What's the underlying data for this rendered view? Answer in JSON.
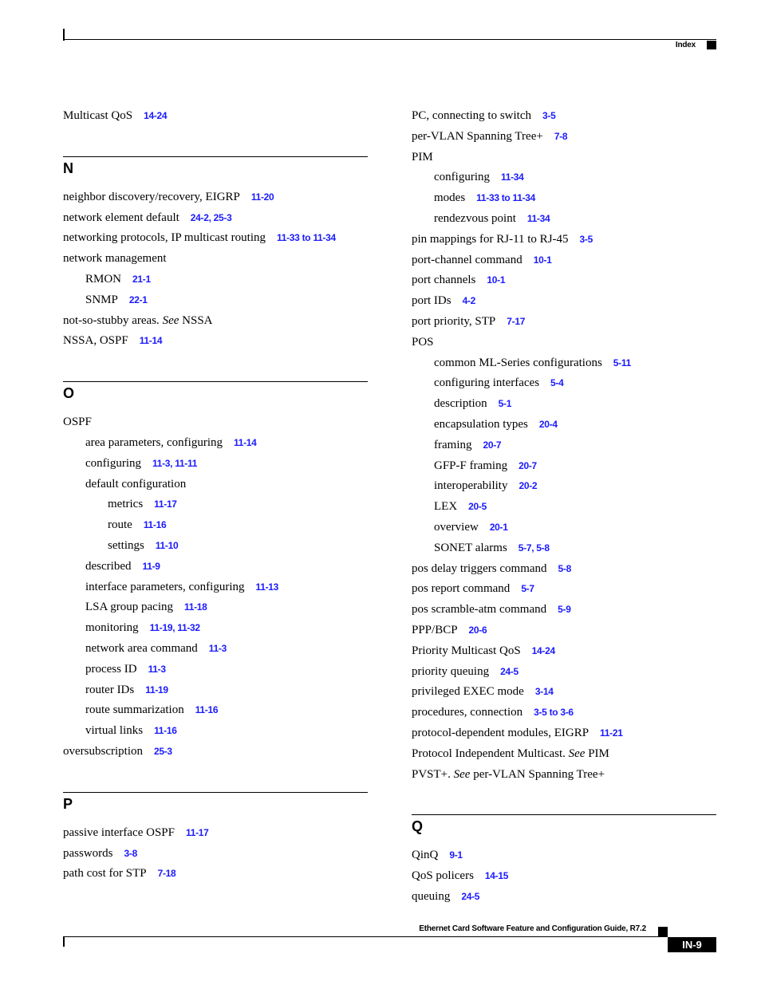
{
  "header": {
    "label": "Index"
  },
  "footer": {
    "title": "Ethernet Card Software Feature and Configuration Guide, R7.2",
    "page": "IN-9"
  },
  "colors": {
    "link": "#1a1aff",
    "text": "#000000"
  },
  "left": {
    "top_entries": [
      {
        "term": "Multicast QoS",
        "pages": "14-24"
      }
    ],
    "sections": [
      {
        "letter": "N",
        "entries": [
          {
            "term": "neighbor discovery/recovery, EIGRP",
            "pages": "11-20",
            "level": 0
          },
          {
            "term": "network element default",
            "pages": "24-2, 25-3",
            "level": 0
          },
          {
            "term": "networking protocols, IP multicast routing",
            "pages": "11-33 to 11-34",
            "level": 0
          },
          {
            "term": "network management",
            "pages": "",
            "level": 0
          },
          {
            "term": "RMON",
            "pages": "21-1",
            "level": 1
          },
          {
            "term": "SNMP",
            "pages": "22-1",
            "level": 1
          },
          {
            "term": "not-so-stubby areas.",
            "see": "See",
            "see_target": "NSSA",
            "pages": "",
            "level": 0
          },
          {
            "term": "NSSA, OSPF",
            "pages": "11-14",
            "level": 0
          }
        ]
      },
      {
        "letter": "O",
        "entries": [
          {
            "term": "OSPF",
            "pages": "",
            "level": 0
          },
          {
            "term": "area parameters, configuring",
            "pages": "11-14",
            "level": 1
          },
          {
            "term": "configuring",
            "pages": "11-3, 11-11",
            "level": 1
          },
          {
            "term": "default configuration",
            "pages": "",
            "level": 1
          },
          {
            "term": "metrics",
            "pages": "11-17",
            "level": 2
          },
          {
            "term": "route",
            "pages": "11-16",
            "level": 2
          },
          {
            "term": "settings",
            "pages": "11-10",
            "level": 2
          },
          {
            "term": "described",
            "pages": "11-9",
            "level": 1
          },
          {
            "term": "interface parameters, configuring",
            "pages": "11-13",
            "level": 1
          },
          {
            "term": "LSA group pacing",
            "pages": "11-18",
            "level": 1
          },
          {
            "term": "monitoring",
            "pages": "11-19, 11-32",
            "level": 1
          },
          {
            "term": "network area command",
            "pages": "11-3",
            "level": 1
          },
          {
            "term": "process ID",
            "pages": "11-3",
            "level": 1
          },
          {
            "term": "router IDs",
            "pages": "11-19",
            "level": 1
          },
          {
            "term": "route summarization",
            "pages": "11-16",
            "level": 1
          },
          {
            "term": "virtual links",
            "pages": "11-16",
            "level": 1
          },
          {
            "term": "oversubscription",
            "pages": "25-3",
            "level": 0
          }
        ]
      },
      {
        "letter": "P",
        "entries": [
          {
            "term": "passive interface OSPF",
            "pages": "11-17",
            "level": 0
          },
          {
            "term": "passwords",
            "pages": "3-8",
            "level": 0
          },
          {
            "term": "path cost for STP",
            "pages": "7-18",
            "level": 0
          }
        ]
      }
    ]
  },
  "right": {
    "top_entries": [
      {
        "term": "PC, connecting to switch",
        "pages": "3-5",
        "level": 0
      },
      {
        "term": "per-VLAN Spanning Tree+",
        "pages": "7-8",
        "level": 0
      },
      {
        "term": "PIM",
        "pages": "",
        "level": 0
      },
      {
        "term": "configuring",
        "pages": "11-34",
        "level": 1
      },
      {
        "term": "modes",
        "pages": "11-33 to 11-34",
        "level": 1
      },
      {
        "term": "rendezvous point",
        "pages": "11-34",
        "level": 1
      },
      {
        "term": "pin mappings for RJ-11 to RJ-45",
        "pages": "3-5",
        "level": 0
      },
      {
        "term": "port-channel command",
        "pages": "10-1",
        "level": 0
      },
      {
        "term": "port channels",
        "pages": "10-1",
        "level": 0
      },
      {
        "term": "port IDs",
        "pages": "4-2",
        "level": 0
      },
      {
        "term": "port priority, STP",
        "pages": "7-17",
        "level": 0
      },
      {
        "term": "POS",
        "pages": "",
        "level": 0
      },
      {
        "term": "common ML-Series configurations",
        "pages": "5-11",
        "level": 1
      },
      {
        "term": "configuring interfaces",
        "pages": "5-4",
        "level": 1
      },
      {
        "term": "description",
        "pages": "5-1",
        "level": 1
      },
      {
        "term": "encapsulation types",
        "pages": "20-4",
        "level": 1
      },
      {
        "term": "framing",
        "pages": "20-7",
        "level": 1
      },
      {
        "term": "GFP-F framing",
        "pages": "20-7",
        "level": 1
      },
      {
        "term": "interoperability",
        "pages": "20-2",
        "level": 1
      },
      {
        "term": "LEX",
        "pages": "20-5",
        "level": 1
      },
      {
        "term": "overview",
        "pages": "20-1",
        "level": 1
      },
      {
        "term": "SONET alarms",
        "pages": "5-7, 5-8",
        "level": 1
      },
      {
        "term": "pos delay triggers command",
        "pages": "5-8",
        "level": 0
      },
      {
        "term": "pos report command",
        "pages": "5-7",
        "level": 0
      },
      {
        "term": "pos scramble-atm command",
        "pages": "5-9",
        "level": 0
      },
      {
        "term": "PPP/BCP",
        "pages": "20-6",
        "level": 0
      },
      {
        "term": "Priority Multicast QoS",
        "pages": "14-24",
        "level": 0
      },
      {
        "term": "priority queuing",
        "pages": "24-5",
        "level": 0
      },
      {
        "term": "privileged EXEC mode",
        "pages": "3-14",
        "level": 0
      },
      {
        "term": "procedures, connection",
        "pages": "3-5 to 3-6",
        "level": 0
      },
      {
        "term": "protocol-dependent modules, EIGRP",
        "pages": "11-21",
        "level": 0
      },
      {
        "term": "Protocol Independent Multicast.",
        "see": "See",
        "see_target": "PIM",
        "pages": "",
        "level": 0
      },
      {
        "term": "PVST+.",
        "see": "See",
        "see_target": "per-VLAN Spanning Tree+",
        "pages": "",
        "level": 0
      }
    ],
    "sections": [
      {
        "letter": "Q",
        "entries": [
          {
            "term": "QinQ",
            "pages": "9-1",
            "level": 0
          },
          {
            "term": "QoS policers",
            "pages": "14-15",
            "level": 0
          },
          {
            "term": "queuing",
            "pages": "24-5",
            "level": 0
          }
        ]
      }
    ]
  }
}
